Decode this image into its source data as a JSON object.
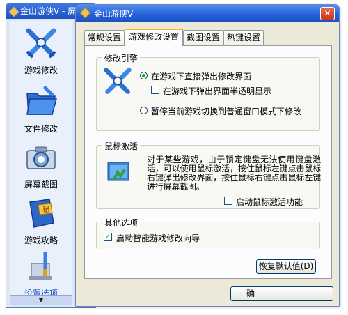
{
  "background_window": {
    "title": "金山游侠V - 屏幕"
  },
  "sidebar": {
    "items": [
      {
        "label": "游戏修改",
        "icon": "crossed-swords-icon"
      },
      {
        "label": "文件修改",
        "icon": "folder-icon"
      },
      {
        "label": "屏幕截图",
        "icon": "camera-icon"
      },
      {
        "label": "游戏攻略",
        "icon": "secret-book-icon"
      },
      {
        "label": "设置选项",
        "icon": "settings-tools-icon"
      }
    ],
    "active_index": 4,
    "scroll_arrow": "▼"
  },
  "dialog": {
    "title": "金山游侠V",
    "close_glyph": "✕",
    "tabs": [
      "常规设置",
      "游戏修改设置",
      "截图设置",
      "热键设置"
    ],
    "active_tab": 1,
    "modify_engine": {
      "title": "修改引擎",
      "radio1": {
        "label": "在游戏下直接弹出修改界面",
        "checked": true
      },
      "check1": {
        "label": "在游戏下弹出界面半透明显示",
        "checked": false
      },
      "radio2": {
        "label": "暂停当前游戏切换到普通窗口模式下修改",
        "checked": false
      }
    },
    "mouse_activate": {
      "title": "鼠标激活",
      "description": "对于某些游戏，由于锁定键盘无法使用键盘激活，可以使用鼠标激活，按住鼠标左键点击鼠标右键弹出修改界面，按住鼠标右键点击鼠标左键进行屏幕截图。",
      "check": {
        "label": "启动鼠标激活功能",
        "checked": false
      }
    },
    "other_options": {
      "title": "其他选项",
      "check": {
        "label": "启动智能游戏修改向导",
        "checked": true
      }
    },
    "restore_button": "恢复默认值(D)",
    "ok_button": "确"
  }
}
